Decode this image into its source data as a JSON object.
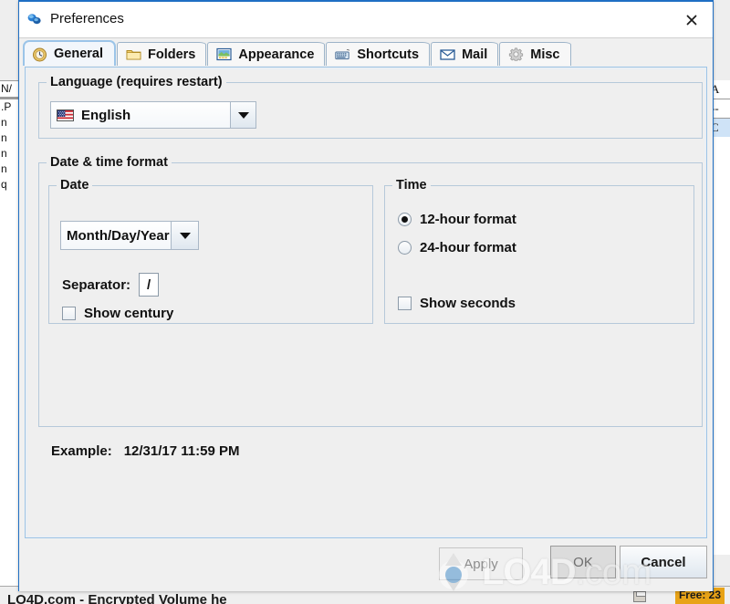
{
  "window": {
    "title": "Preferences",
    "title_icon": "preferences-icon",
    "close_label": "×",
    "close_icon": "close-icon",
    "accent_color": "#1f6fc4",
    "background_color": "#f0f0f0"
  },
  "tabs": [
    {
      "label": "General",
      "icon": "clock-icon",
      "active": true
    },
    {
      "label": "Folders",
      "icon": "folder-icon",
      "active": false
    },
    {
      "label": "Appearance",
      "icon": "monitor-icon",
      "active": false
    },
    {
      "label": "Shortcuts",
      "icon": "keyboard-icon",
      "active": false
    },
    {
      "label": "Mail",
      "icon": "envelope-icon",
      "active": false
    },
    {
      "label": "Misc",
      "icon": "gear-icon",
      "active": false
    }
  ],
  "general": {
    "language_group": {
      "title": "Language (requires restart)",
      "combo": {
        "value": "English",
        "icon": "us-flag-icon",
        "options": [
          "English"
        ]
      }
    },
    "datetime_group": {
      "title": "Date & time format",
      "date_group": {
        "title": "Date",
        "format_combo": {
          "value": "Month/Day/Year",
          "options": [
            "Month/Day/Year"
          ]
        },
        "separator_label": "Separator:",
        "separator_value": "/",
        "show_century": {
          "label": "Show century",
          "checked": false
        }
      },
      "time_group": {
        "title": "Time",
        "radios": [
          {
            "label": "12-hour format",
            "checked": true
          },
          {
            "label": "24-hour format",
            "checked": false
          }
        ],
        "show_seconds": {
          "label": "Show seconds",
          "checked": false
        }
      },
      "example_label": "Example:",
      "example_value": "12/31/17 11:59 PM"
    }
  },
  "footer": {
    "apply_label": "Apply",
    "apply_disabled": true,
    "ok_label": "OK",
    "cancel_label": "Cancel"
  },
  "background": {
    "left_rows": [
      "N/",
      "",
      "",
      "",
      ".P",
      "n",
      "n",
      "n",
      "n",
      "q"
    ],
    "right_rows": [
      "A",
      "--",
      "C"
    ],
    "bottom_text": "LO4D.com - Encrypted Volume he",
    "status_free": "Free: 23",
    "status_icon": "drive-icon"
  },
  "watermark": {
    "text_main": "LO4D",
    "text_suffix": ".com",
    "logo_icon": "lo4d-recycle-icon"
  }
}
